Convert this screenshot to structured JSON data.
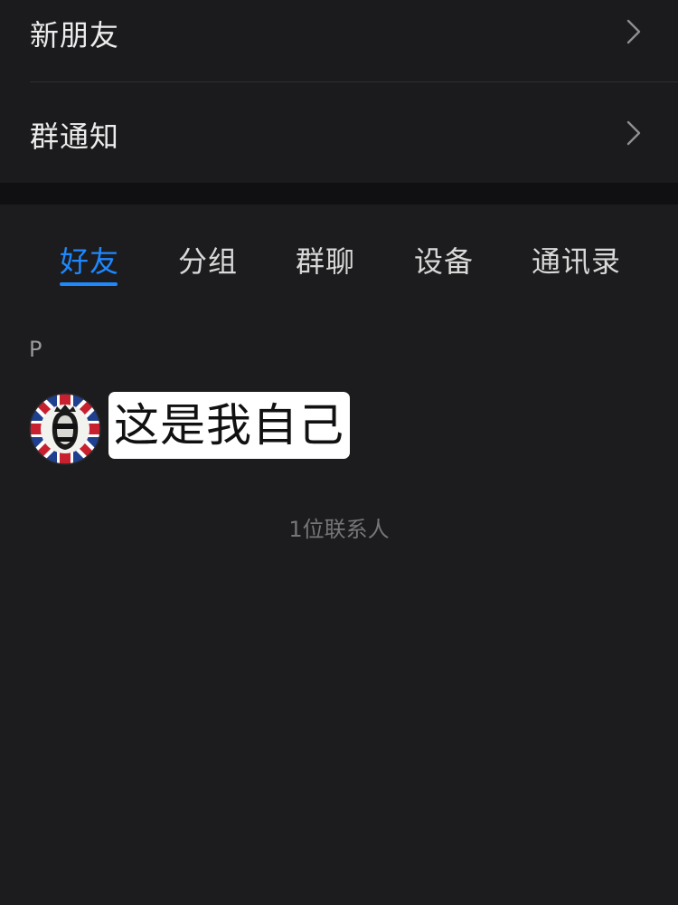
{
  "menu": {
    "new_friends": "新朋友",
    "group_notice": "群通知"
  },
  "tabs": [
    {
      "label": "好友",
      "active": true
    },
    {
      "label": "分组",
      "active": false
    },
    {
      "label": "群聊",
      "active": false
    },
    {
      "label": "设备",
      "active": false
    },
    {
      "label": "通讯录",
      "active": false
    }
  ],
  "section": {
    "letter": "P"
  },
  "contact": {
    "avatar_icon": "punk-queen-badge-icon",
    "caption": "这是我自己"
  },
  "count_text": "1位联系人",
  "colors": {
    "background": "#1c1c1e",
    "accent": "#1e88ff",
    "band": "#101012"
  }
}
